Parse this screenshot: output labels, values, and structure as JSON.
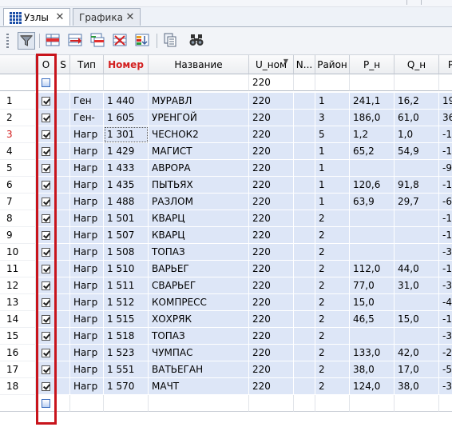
{
  "tabs": [
    {
      "label": "Узлы",
      "active": true,
      "icon": "nodes-grid-icon",
      "close": "✕"
    },
    {
      "label": "Графика",
      "active": false,
      "close": "✕"
    }
  ],
  "toolbar": {
    "buttons": [
      {
        "name": "filter-button",
        "icon": "filter-funnel-icon",
        "pressed": true
      },
      {
        "name": "insert-row-button",
        "icon": "insert-row-icon"
      },
      {
        "name": "add-row-button",
        "icon": "add-row-icon"
      },
      {
        "name": "copy-row-button",
        "icon": "copy-row-icon"
      },
      {
        "name": "delete-row-button",
        "icon": "delete-row-icon"
      },
      {
        "name": "sort-button",
        "icon": "sort-icon"
      },
      {
        "name": "copy-table-button",
        "icon": "copy-icon"
      },
      {
        "name": "find-button",
        "icon": "binoculars-icon"
      }
    ]
  },
  "columns": [
    {
      "key": "num",
      "label": ""
    },
    {
      "key": "o",
      "label": "О"
    },
    {
      "key": "s",
      "label": "S"
    },
    {
      "key": "tip",
      "label": "Тип"
    },
    {
      "key": "nomer",
      "label": "Номер",
      "highlight": "#d32020"
    },
    {
      "key": "nazv",
      "label": "Название"
    },
    {
      "key": "unom",
      "label": "U_ном",
      "filtered": true
    },
    {
      "key": "n",
      "label": "N..."
    },
    {
      "key": "rayon",
      "label": "Район"
    },
    {
      "key": "pn",
      "label": "P_н"
    },
    {
      "key": "qn",
      "label": "Q_н"
    },
    {
      "key": "pg",
      "label": "P"
    }
  ],
  "filter": {
    "unom": "220"
  },
  "current_row_number": "3",
  "rows": [
    {
      "num": "1",
      "checked": true,
      "tip": "Ген",
      "nomer": "1 440",
      "nazv": "МУРАВЛ",
      "unom": "220",
      "rayon": "1",
      "pn": "241,1",
      "qn": "16,2",
      "pg": "19"
    },
    {
      "num": "2",
      "checked": true,
      "tip": "Ген-",
      "nomer": "1 605",
      "nazv": "УРЕНГОЙ",
      "unom": "220",
      "rayon": "3",
      "pn": "186,0",
      "qn": "61,0",
      "pg": "36"
    },
    {
      "num": "3",
      "checked": true,
      "tip": "Нагр",
      "nomer": "1 301",
      "nazv": "ЧЕСНОК2",
      "unom": "220",
      "rayon": "5",
      "pn": "1,2",
      "qn": "1,0",
      "pg": "-1"
    },
    {
      "num": "4",
      "checked": true,
      "tip": "Нагр",
      "nomer": "1 429",
      "nazv": "МАГИСТ",
      "unom": "220",
      "rayon": "1",
      "pn": "65,2",
      "qn": "54,9",
      "pg": "-1"
    },
    {
      "num": "5",
      "checked": true,
      "tip": "Нагр",
      "nomer": "1 433",
      "nazv": "АВРОРА",
      "unom": "220",
      "rayon": "1",
      "pn": "",
      "qn": "",
      "pg": "-9"
    },
    {
      "num": "6",
      "checked": true,
      "tip": "Нагр",
      "nomer": "1 435",
      "nazv": "ПЫТЬЯХ",
      "unom": "220",
      "rayon": "1",
      "pn": "120,6",
      "qn": "91,8",
      "pg": "-1"
    },
    {
      "num": "7",
      "checked": true,
      "tip": "Нагр",
      "nomer": "1 488",
      "nazv": "РАЗЛОМ",
      "unom": "220",
      "rayon": "1",
      "pn": "63,9",
      "qn": "29,7",
      "pg": "-6"
    },
    {
      "num": "8",
      "checked": true,
      "tip": "Нагр",
      "nomer": "1 501",
      "nazv": "КВАРЦ",
      "unom": "220",
      "rayon": "2",
      "pn": "",
      "qn": "",
      "pg": "-1"
    },
    {
      "num": "9",
      "checked": true,
      "tip": "Нагр",
      "nomer": "1 507",
      "nazv": "КВАРЦ",
      "unom": "220",
      "rayon": "2",
      "pn": "",
      "qn": "",
      "pg": "-1"
    },
    {
      "num": "10",
      "checked": true,
      "tip": "Нагр",
      "nomer": "1 508",
      "nazv": "ТОПАЗ",
      "unom": "220",
      "rayon": "2",
      "pn": "",
      "qn": "",
      "pg": "-3"
    },
    {
      "num": "11",
      "checked": true,
      "tip": "Нагр",
      "nomer": "1 510",
      "nazv": "ВАРЬЕГ",
      "unom": "220",
      "rayon": "2",
      "pn": "112,0",
      "qn": "44,0",
      "pg": "-1"
    },
    {
      "num": "12",
      "checked": true,
      "tip": "Нагр",
      "nomer": "1 511",
      "nazv": "СВАРЬЕГ",
      "unom": "220",
      "rayon": "2",
      "pn": "77,0",
      "qn": "31,0",
      "pg": "-3"
    },
    {
      "num": "13",
      "checked": true,
      "tip": "Нагр",
      "nomer": "1 512",
      "nazv": "КОМПРЕСС",
      "unom": "220",
      "rayon": "2",
      "pn": "15,0",
      "qn": "",
      "pg": "-4"
    },
    {
      "num": "14",
      "checked": true,
      "tip": "Нагр",
      "nomer": "1 515",
      "nazv": "ХОХРЯК",
      "unom": "220",
      "rayon": "2",
      "pn": "46,5",
      "qn": "15,0",
      "pg": "-1"
    },
    {
      "num": "15",
      "checked": true,
      "tip": "Нагр",
      "nomer": "1 518",
      "nazv": "ТОПАЗ",
      "unom": "220",
      "rayon": "2",
      "pn": "",
      "qn": "",
      "pg": "-3"
    },
    {
      "num": "16",
      "checked": true,
      "tip": "Нагр",
      "nomer": "1 523",
      "nazv": "ЧУМПАС",
      "unom": "220",
      "rayon": "2",
      "pn": "133,0",
      "qn": "42,0",
      "pg": "-2"
    },
    {
      "num": "17",
      "checked": true,
      "tip": "Нагр",
      "nomer": "1 551",
      "nazv": "ВАТЬЕГАН",
      "unom": "220",
      "rayon": "2",
      "pn": "38,0",
      "qn": "17,0",
      "pg": "-5"
    },
    {
      "num": "18",
      "checked": true,
      "tip": "Нагр",
      "nomer": "1 570",
      "nazv": "МАЧТ",
      "unom": "220",
      "rayon": "2",
      "pn": "124,0",
      "qn": "38,0",
      "pg": "-3"
    }
  ],
  "colors": {
    "selected_row": "#dde6f7",
    "highlight_box": "#c8141c",
    "header_red": "#d32020"
  }
}
